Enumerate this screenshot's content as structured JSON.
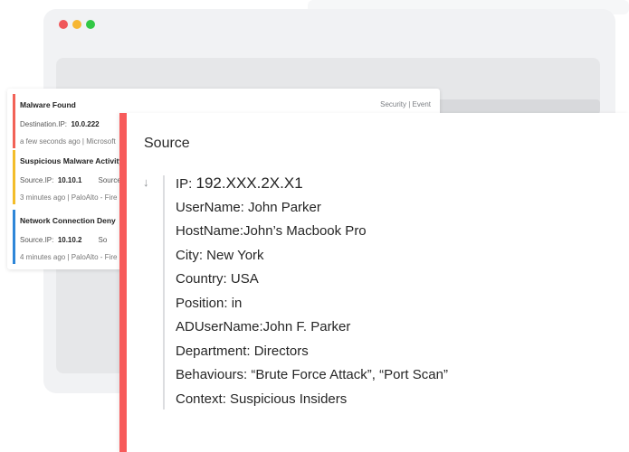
{
  "background_window": {
    "dots": [
      "close-dot",
      "minimize-dot",
      "maximize-dot"
    ]
  },
  "alerts": {
    "tag": "Security | Event",
    "items": [
      {
        "title": "Malware Found",
        "field_label": "Destination.IP:",
        "field_value": "10.0.222",
        "second_label": "",
        "time_source": "a few seconds ago | Microsoft",
        "color": "#f26257"
      },
      {
        "title": "Suspicious Malware Activity",
        "field_label": "Source.IP:",
        "field_value": "10.10.1",
        "second_label": "Source",
        "time_source": "3 minutes ago | PaloAlto - Fire",
        "color": "#f3bd2a"
      },
      {
        "title": "Network Connection Deny",
        "field_label": "Source.IP:",
        "field_value": "10.10.2",
        "second_label": "So",
        "time_source": "4 minutes ago | PaloAlto - Fire",
        "color": "#2e86d8"
      }
    ]
  },
  "detail": {
    "title": "Source",
    "expand_icon": "arrow-down-icon",
    "ip_label": "IP: ",
    "ip_value": "192.XXX.2X.X1",
    "fields": [
      "UserName: John Parker",
      "HostName:John’s Macbook Pro",
      "City: New York",
      "Country: USA",
      "Position: in",
      "ADUserName:John F. Parker",
      "Department: Directors",
      "Behaviours: “Brute Force Attack”, “Port Scan”",
      "Context: Suspicious Insiders"
    ],
    "accent_color": "#f75a5a"
  }
}
